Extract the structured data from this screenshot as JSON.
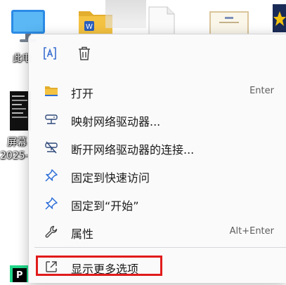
{
  "desktop": {
    "icons": [
      {
        "label": "此电",
        "icon": "monitor-icon"
      },
      {
        "label": "",
        "icon": "folder-icon"
      },
      {
        "label": "",
        "icon": "file-icon"
      },
      {
        "label": "",
        "icon": "certificate-icon"
      },
      {
        "label": "屏幕",
        "sub_label": "2025-",
        "icon": "terminal-icon"
      },
      {
        "label": "",
        "icon": "pycharm-icon"
      }
    ]
  },
  "context_menu": {
    "top_actions": [
      {
        "name": "translate",
        "icon": "translate-icon"
      },
      {
        "name": "delete",
        "icon": "trash-icon"
      }
    ],
    "items": [
      {
        "label": "打开",
        "shortcut": "Enter",
        "icon": "folder-icon"
      },
      {
        "label": "映射网络驱动器...",
        "shortcut": "",
        "icon": "network-drive-icon"
      },
      {
        "label": "断开网络驱动器的连接...",
        "shortcut": "",
        "icon": "disconnect-drive-icon"
      },
      {
        "label": "固定到快速访问",
        "shortcut": "",
        "icon": "pin-icon"
      },
      {
        "label": "固定到“开始”",
        "shortcut": "",
        "icon": "pin-icon"
      },
      {
        "label": "属性",
        "shortcut": "Alt+Enter",
        "icon": "wrench-icon"
      }
    ],
    "more_options": {
      "label": "显示更多选项",
      "icon": "open-external-icon"
    }
  },
  "colors": {
    "accent": "#2e6fd8",
    "highlight_border": "#e11b1b",
    "folder_yellow": "#f5c342"
  }
}
